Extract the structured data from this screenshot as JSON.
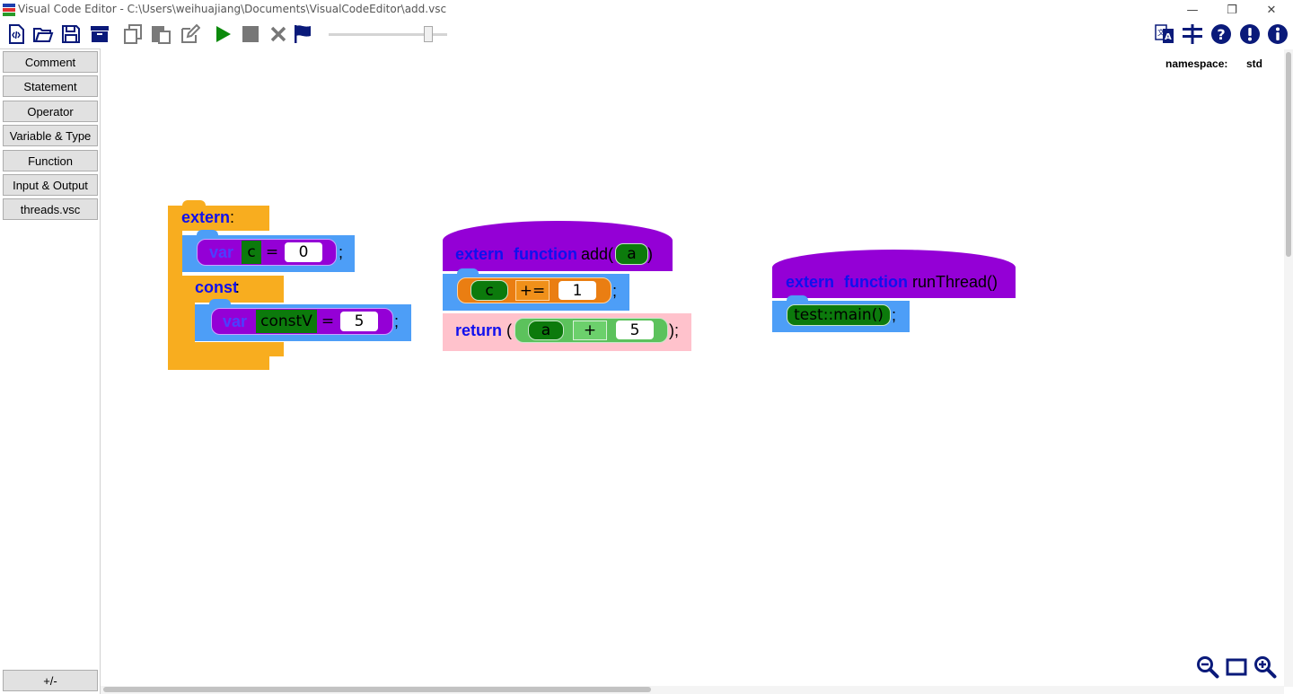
{
  "window": {
    "title": "Visual Code Editor - C:\\Users\\weihuajiang\\Documents\\VisualCodeEditor\\add.vsc",
    "minimize_glyph": "—",
    "restore_glyph": "❐",
    "close_glyph": "✕"
  },
  "toolbar": {
    "icons": [
      "new-file-icon",
      "open-folder-icon",
      "save-icon",
      "archive-icon",
      "copy-icon",
      "paste-icon",
      "edit-icon",
      "run-icon",
      "stop-icon",
      "cancel-icon",
      "flag-icon",
      "translate-icon",
      "settings-icon",
      "help-icon",
      "alert-icon",
      "info-icon"
    ],
    "zoom_slider_value": 0.87,
    "colors": {
      "primary": "#0a1a7a",
      "run": "#0c8a0c",
      "stop": "#777777",
      "gray": "#7a7a7a"
    }
  },
  "sidebar": {
    "categories": [
      "Comment",
      "Statement",
      "Operator",
      "Variable & Type",
      "Function",
      "Input & Output",
      "threads.vsc"
    ],
    "toggle_label": "+/-"
  },
  "canvas": {
    "namespace_label": "namespace:",
    "namespace_value": "std",
    "extern_block": {
      "label_kw": "extern",
      "label_colon": ":",
      "var1": {
        "kw": "var",
        "name": "c",
        "op": "=",
        "value": "0",
        "semi": ";"
      },
      "const_kw": "const",
      "const_colon": ":",
      "var2": {
        "kw": "var",
        "name": "constV",
        "op": "=",
        "value": "5",
        "semi": ";"
      }
    },
    "add_func": {
      "kw1": "extern",
      "kw2": "function",
      "name": "add(",
      "param": "a",
      "close": ")",
      "stmt": {
        "var": "c",
        "op": "+=",
        "value": "1",
        "semi": ";"
      },
      "ret": {
        "kw": "return",
        "open": "(",
        "var": "a",
        "op": "+",
        "value": "5",
        "close": ");"
      }
    },
    "run_thread_func": {
      "kw1": "extern",
      "kw2": "function",
      "name": "runThread()",
      "call": "test::main()",
      "semi": ";"
    }
  },
  "zoom_controls": [
    "zoom-out-icon",
    "fit-icon",
    "zoom-in-icon"
  ]
}
